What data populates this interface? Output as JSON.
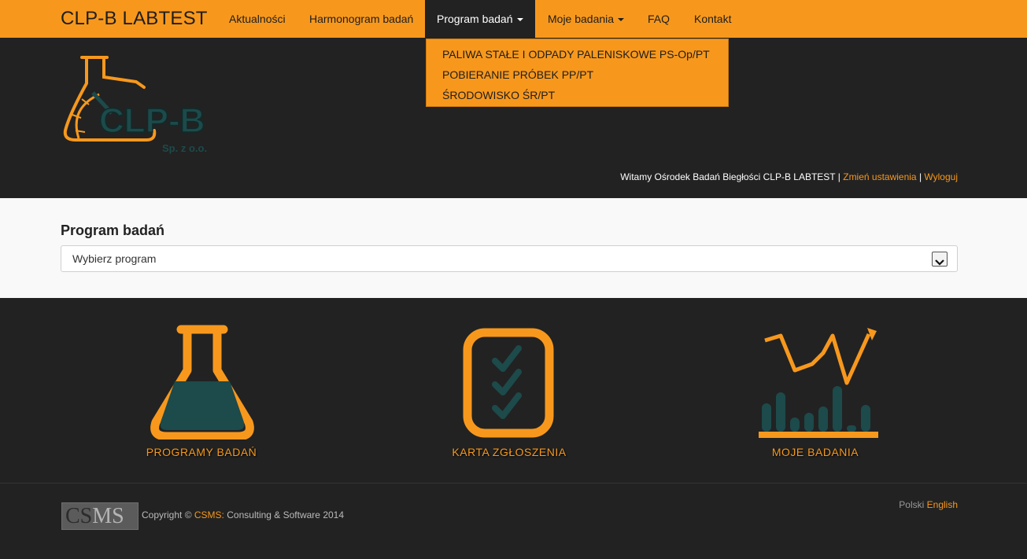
{
  "navbar": {
    "brand": "CLP-B LABTEST",
    "items": [
      {
        "label": "Aktualności"
      },
      {
        "label": "Harmonogram badań"
      },
      {
        "label": "Program badań"
      },
      {
        "label": "Moje badania"
      },
      {
        "label": "FAQ"
      },
      {
        "label": "Kontakt"
      }
    ],
    "dropdown": [
      "PALIWA STAŁE I ODPADY PALENISKOWE PS-Op/PT",
      "POBIERANIE PRÓBEK PP/PT",
      "ŚRODOWISKO ŚR/PT"
    ]
  },
  "logo": {
    "text": "CLP-B",
    "subtext": "Sp. z o.o."
  },
  "welcome": {
    "text": "Witamy Ośrodek Badań Biegłości CLP-B LABTEST",
    "sep": "|",
    "settings": "Zmień ustawienia",
    "logout": "Wyloguj"
  },
  "program": {
    "heading": "Program badań",
    "select_value": "Wybierz program"
  },
  "tiles": [
    {
      "label": "PROGRAMY BADAŃ",
      "icon": "flask-icon"
    },
    {
      "label": "KARTA ZGŁOSZENIA",
      "icon": "checklist-icon"
    },
    {
      "label": "MOJE BADANIA",
      "icon": "chart-icon"
    }
  ],
  "footer": {
    "logo_cs": "CS",
    "logo_ms": "MS",
    "copyright_prefix": "Copyright ©",
    "company": "CSMS:",
    "copyright_suffix": "Consulting & Software 2014",
    "lang_pl": "Polski",
    "lang_en": "English"
  },
  "colors": {
    "accent": "#f7981d",
    "dark": "#222222",
    "teal": "#1d4a4a"
  }
}
